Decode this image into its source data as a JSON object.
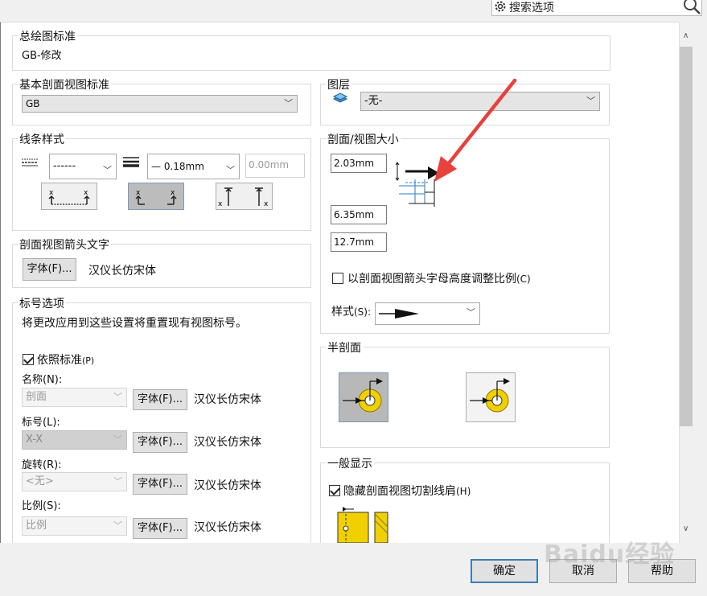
{
  "search": {
    "placeholder": "搜索选项"
  },
  "overall_standard": {
    "title": "总绘图标准",
    "value": "GB-修改"
  },
  "base_section_standard": {
    "title": "基本剖面视图标准",
    "value": "GB"
  },
  "layer": {
    "title": "图层",
    "value": "-无-"
  },
  "line_style": {
    "title": "线条样式",
    "dash_value": "------",
    "thickness_value": "— 0.18mm",
    "custom_thickness": "0.00mm"
  },
  "section_size": {
    "title": "剖面/视图大小",
    "val1": "2.03mm",
    "val2": "6.35mm",
    "val3": "12.7mm",
    "scale_checkbox": "以剖面视图箭头字母高度调整比例",
    "scale_hotkey": "(C)",
    "style_label": "样式",
    "style_hotkey": "(S):"
  },
  "arrow_text": {
    "title": "剖面视图箭头文字",
    "font_button": "字体(F)...",
    "font_name": "汉仪长仿宋体"
  },
  "label_options": {
    "title": "标号选项",
    "note": "将更改应用到这些设置将重置现有视图标号。",
    "per_standard": "依照标准",
    "per_standard_hotkey": "(P)",
    "name_label": "名称(N):",
    "name_value": "剖面",
    "label_label": "标号(L):",
    "label_value": "X-X",
    "rotation_label": "旋转(R):",
    "rotation_value": "<无>",
    "scale_label": "比例(S):",
    "scale_value": "比例",
    "font_button": "字体(F)...",
    "font_name": "汉仪长仿宋体"
  },
  "half_section": {
    "title": "半剖面"
  },
  "general_display": {
    "title": "一般显示",
    "hide_shoulders": "隐藏剖面视图切割线肩",
    "hide_hotkey": "(H)"
  },
  "buttons": {
    "ok": "确定",
    "cancel": "取消",
    "help": "帮助"
  },
  "watermark": "Baidu经验",
  "colors": {
    "accent_red": "#e8413c",
    "default_button_border": "#3c7fb1",
    "yellow_icon": "#f0d000"
  }
}
